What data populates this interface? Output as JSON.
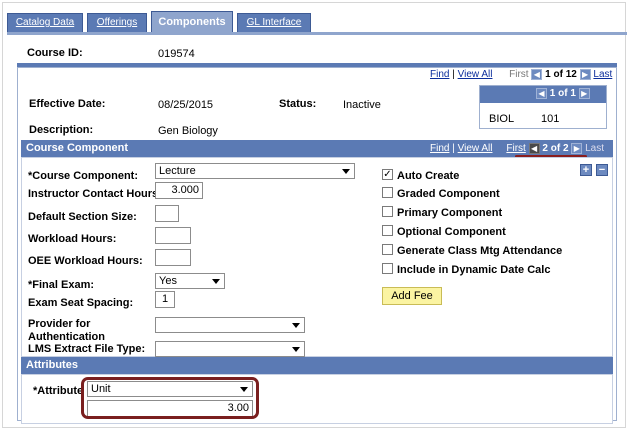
{
  "tabs": [
    {
      "label": "Catalog Data"
    },
    {
      "label": "Offerings"
    },
    {
      "label": "Components"
    },
    {
      "label": "GL Interface"
    }
  ],
  "course": {
    "id_label": "Course ID:",
    "id_value": "019574"
  },
  "top_nav": {
    "find": "Find",
    "sep": "|",
    "view_all": "View All",
    "first": "First",
    "range": "1 of 12",
    "last": "Last"
  },
  "effective": {
    "date_label": "Effective Date:",
    "date_value": "08/25/2015",
    "status_label": "Status:",
    "status_value": "Inactive",
    "desc_label": "Description:",
    "desc_value": "Gen Biology"
  },
  "subject_grid": {
    "range": "1 of 1",
    "subject": "BIOL",
    "catalog": "101"
  },
  "component_section": {
    "title": "Course Component",
    "nav": {
      "find": "Find",
      "sep": "|",
      "view_all": "View All",
      "first": "First",
      "range": "2 of 2",
      "last": "Last"
    },
    "plus": "+",
    "minus": "−"
  },
  "fields": {
    "course_component_label": "*Course Component:",
    "course_component_value": "Lecture",
    "instructor_hours_label": "Instructor Contact Hours:",
    "instructor_hours_value": "3.000",
    "default_section_label": "Default Section Size:",
    "default_section_value": "",
    "workload_label": "Workload Hours:",
    "workload_value": "",
    "oee_label": "OEE Workload Hours:",
    "oee_value": "",
    "final_exam_label": "*Final Exam:",
    "final_exam_value": "Yes",
    "exam_seat_label": "Exam Seat Spacing:",
    "exam_seat_value": "1",
    "provider_label_1": "Provider for",
    "provider_label_2": "Authentication",
    "provider_value": "",
    "lms_label": "LMS Extract File Type:",
    "lms_value": ""
  },
  "checkboxes": [
    {
      "label": "Auto Create",
      "checked": true,
      "mark": "✓"
    },
    {
      "label": "Graded Component",
      "checked": false,
      "mark": ""
    },
    {
      "label": "Primary Component",
      "checked": false,
      "mark": ""
    },
    {
      "label": "Optional Component",
      "checked": false,
      "mark": ""
    },
    {
      "label": "Generate Class Mtg Attendance",
      "checked": false,
      "mark": ""
    },
    {
      "label": "Include in Dynamic Date Calc",
      "checked": false,
      "mark": ""
    }
  ],
  "add_fee_label": "Add Fee",
  "attributes": {
    "title": "Attributes",
    "attribute_label": "*Attribute",
    "attribute_value": "Unit",
    "amount_value": "3.00"
  },
  "colors": {
    "header_blue": "#5b7ab4",
    "annotation_red": "#7a1f1f"
  }
}
